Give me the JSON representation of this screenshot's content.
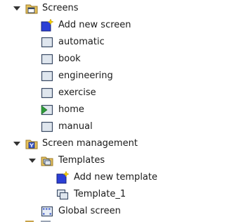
{
  "tree": {
    "screens": {
      "label": "Screens",
      "items": {
        "add_new_screen": "Add new screen",
        "automatic": "automatic",
        "book": "book",
        "engineering": "engineering",
        "exercise": "exercise",
        "home": "home",
        "manual": "manual"
      }
    },
    "screen_management": {
      "label": "Screen management",
      "templates": {
        "label": "Templates",
        "add_new_template": "Add new template",
        "template_1": "Template_1"
      },
      "global_screen": "Global screen"
    }
  },
  "colors": {
    "folder": "#e8c25a",
    "screen_fill": "#dfe6ee",
    "screen_border": "#3a4a64",
    "add_blue": "#2b3fd6",
    "sparkle": "#f5d000",
    "home_green": "#2e9a3a"
  },
  "icons": {
    "folder": "folder-icon",
    "screen": "screen-icon",
    "add": "add-new-icon",
    "start_screen": "start-screen-icon",
    "management_folder": "management-folder-icon",
    "template": "template-icon",
    "global": "global-screen-icon"
  }
}
